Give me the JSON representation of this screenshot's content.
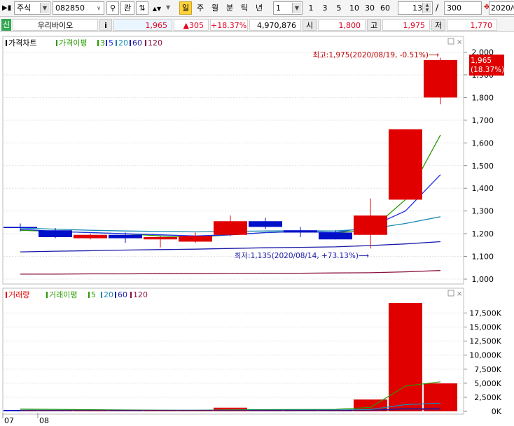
{
  "toolbar": {
    "market": "주식",
    "code": "082850",
    "btn_gwan": "관",
    "periods": [
      {
        "label": "일",
        "active": true
      },
      {
        "label": "주",
        "active": false
      },
      {
        "label": "월",
        "active": false
      },
      {
        "label": "분",
        "active": false
      },
      {
        "label": "틱",
        "active": false
      },
      {
        "label": "년",
        "active": false
      }
    ],
    "interval": "1",
    "presets": [
      "1",
      "3",
      "5",
      "10",
      "30",
      "60"
    ],
    "view_count": "13",
    "separator": "/",
    "total_count": "300",
    "date": "2020/0"
  },
  "info": {
    "badge": "신",
    "name": "우리바이오",
    "i_label": "i",
    "price": "1,965",
    "change": "▲305",
    "change_pct": "+18.37%",
    "volume": "4,970,876",
    "open_label": "시",
    "open": "1,800",
    "high_label": "고",
    "high": "1,975",
    "low_label": "저",
    "low": "1,770"
  },
  "colors": {
    "up": "#e00000",
    "down": "#0010c8",
    "ma3": "#2a9a00",
    "ma5": "#1c2ee8",
    "ma20": "#1a8ab4",
    "ma60": "#1a1aa8",
    "ma120": "#8a1040"
  },
  "chart_data": [
    {
      "type": "candlestick",
      "legend": [
        {
          "text": "가격차트",
          "color": "#000000"
        },
        {
          "text": "가격이평",
          "color": "#2a9a00"
        },
        {
          "text": "3",
          "color": "#2a9a00"
        },
        {
          "text": "5",
          "color": "#1c2ee8"
        },
        {
          "text": "20",
          "color": "#1a8ab4"
        },
        {
          "text": "60",
          "color": "#1a1aa8"
        },
        {
          "text": "120",
          "color": "#8a1040"
        }
      ],
      "yticks": [
        {
          "value": 1000,
          "label": "1,000"
        },
        {
          "value": 1100,
          "label": "1,100"
        },
        {
          "value": 1200,
          "label": "1,200"
        },
        {
          "value": 1300,
          "label": "1,300"
        },
        {
          "value": 1400,
          "label": "1,400"
        },
        {
          "value": 1500,
          "label": "1,500"
        },
        {
          "value": 1600,
          "label": "1,600"
        },
        {
          "value": 1700,
          "label": "1,700"
        },
        {
          "value": 1800,
          "label": "1,800"
        },
        {
          "value": 1900,
          "label": "1,900"
        },
        {
          "value": 2000,
          "label": "2,000"
        }
      ],
      "ylim": [
        1000,
        2000
      ],
      "last_price_label": "1,965",
      "last_pct_label": "(18.37%)",
      "candles": [
        {
          "o": 1230,
          "h": 1245,
          "l": 1210,
          "c": 1225
        },
        {
          "o": 1215,
          "h": 1225,
          "l": 1180,
          "c": 1185
        },
        {
          "o": 1180,
          "h": 1200,
          "l": 1175,
          "c": 1195
        },
        {
          "o": 1195,
          "h": 1205,
          "l": 1160,
          "c": 1180
        },
        {
          "o": 1175,
          "h": 1190,
          "l": 1140,
          "c": 1185
        },
        {
          "o": 1165,
          "h": 1205,
          "l": 1160,
          "c": 1190
        },
        {
          "o": 1195,
          "h": 1280,
          "l": 1190,
          "c": 1255
        },
        {
          "o": 1255,
          "h": 1270,
          "l": 1220,
          "c": 1230
        },
        {
          "o": 1215,
          "h": 1230,
          "l": 1185,
          "c": 1205
        },
        {
          "o": 1205,
          "h": 1215,
          "l": 1175,
          "c": 1175
        },
        {
          "o": 1195,
          "h": 1355,
          "l": 1135,
          "c": 1280
        },
        {
          "o": 1350,
          "h": 1660,
          "l": 1350,
          "c": 1660
        },
        {
          "o": 1800,
          "h": 1975,
          "l": 1770,
          "c": 1965
        }
      ],
      "ma": [
        {
          "period": "3",
          "color": "#2a9a00",
          "values": [
            1215,
            1210,
            1205,
            1200,
            1190,
            1185,
            1195,
            1205,
            1210,
            1205,
            1215,
            1350,
            1635
          ]
        },
        {
          "period": "5",
          "color": "#1c2ee8",
          "values": [
            1220,
            1210,
            1205,
            1200,
            1195,
            1190,
            1195,
            1205,
            1210,
            1205,
            1230,
            1300,
            1460
          ]
        },
        {
          "period": "20",
          "color": "#1a8ab4",
          "values": [
            1225,
            1220,
            1215,
            1212,
            1210,
            1208,
            1210,
            1212,
            1213,
            1212,
            1222,
            1245,
            1275
          ]
        },
        {
          "period": "60",
          "color": "#1a1aa8",
          "values": [
            1120,
            1123,
            1125,
            1128,
            1130,
            1132,
            1135,
            1138,
            1140,
            1142,
            1148,
            1155,
            1165
          ]
        },
        {
          "period": "120",
          "color": "#8a1040",
          "values": [
            1022,
            1022,
            1023,
            1023,
            1024,
            1024,
            1025,
            1026,
            1026,
            1027,
            1028,
            1032,
            1038
          ]
        }
      ],
      "high_annotation": "최고:1,975(2020/08/19, -0.51%)⟶",
      "low_annotation": "최저:1,135(2020/08/14, +73.13%)⟶"
    },
    {
      "type": "bar",
      "legend": [
        {
          "text": "거래량",
          "color": "#e00000"
        },
        {
          "text": "거래이평",
          "color": "#2a9a00"
        },
        {
          "text": "5",
          "color": "#2a9a00"
        },
        {
          "text": "20",
          "color": "#1a8ab4"
        },
        {
          "text": "60",
          "color": "#1a1aa8"
        },
        {
          "text": "120",
          "color": "#8a1040"
        }
      ],
      "yticks": [
        {
          "value": 0,
          "label": "0K"
        },
        {
          "value": 2500,
          "label": "2,500K"
        },
        {
          "value": 5000,
          "label": "5,000K"
        },
        {
          "value": 7500,
          "label": "7,500K"
        },
        {
          "value": 10000,
          "label": "10,000K"
        },
        {
          "value": 12500,
          "label": "12,500K"
        },
        {
          "value": 15000,
          "label": "15,000K"
        },
        {
          "value": 17500,
          "label": "17,500K"
        }
      ],
      "ylim": [
        0,
        19800
      ],
      "volumes": [
        250,
        200,
        150,
        150,
        200,
        250,
        650,
        300,
        250,
        280,
        2100,
        19300,
        4970
      ],
      "ma": [
        {
          "period": "5",
          "color": "#2a9a00",
          "values": [
            400,
            350,
            300,
            250,
            200,
            190,
            280,
            310,
            330,
            350,
            700,
            4500,
            5250
          ]
        },
        {
          "period": "20",
          "color": "#1a8ab4",
          "values": [
            220,
            215,
            212,
            210,
            208,
            210,
            230,
            240,
            245,
            250,
            320,
            1200,
            1450
          ]
        },
        {
          "period": "60",
          "color": "#1a1aa8",
          "values": [
            150,
            150,
            150,
            150,
            150,
            150,
            155,
            158,
            160,
            162,
            190,
            480,
            560
          ]
        },
        {
          "period": "120",
          "color": "#8a1040",
          "values": [
            110,
            110,
            110,
            110,
            110,
            110,
            112,
            113,
            114,
            115,
            130,
            270,
            310
          ]
        }
      ],
      "x_labels": [
        {
          "index": 0,
          "label": "07"
        },
        {
          "index": 1,
          "label": "08"
        }
      ]
    }
  ]
}
